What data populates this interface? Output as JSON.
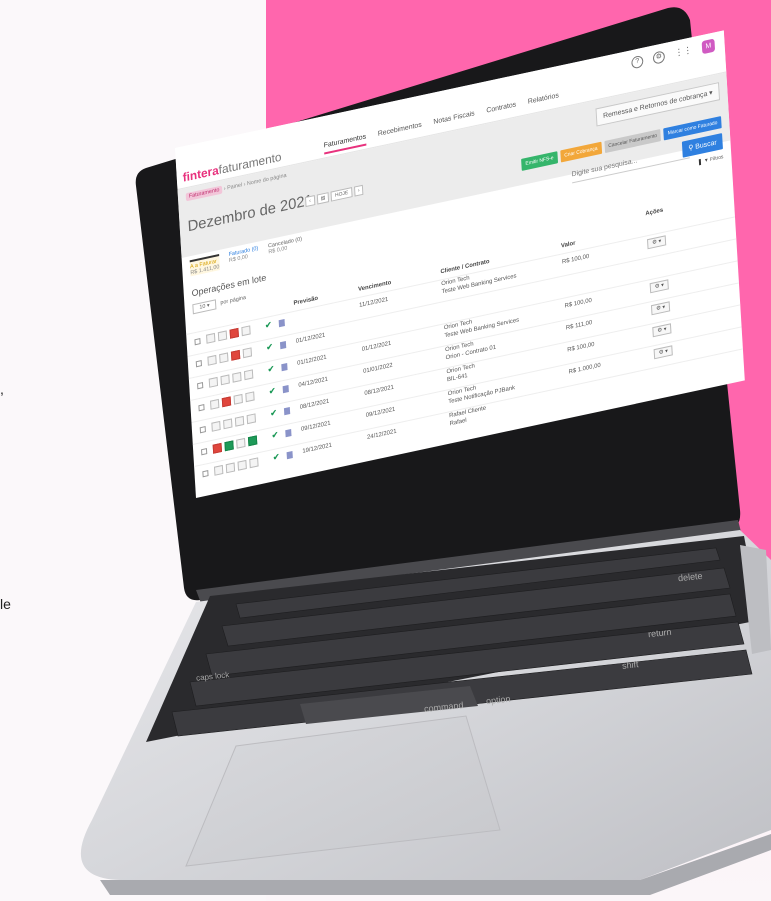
{
  "left_fragments": {
    "line1": ",",
    "line2": "le"
  },
  "colors": {
    "accent": "#e8317d",
    "pink_bg": "#ff66ad",
    "blue": "#2f80e0",
    "green": "#35b56b"
  },
  "app": {
    "logo_brand": "fintera",
    "logo_product": "faturamento",
    "nav": [
      "Faturamentos",
      "Recebimentos",
      "Notas Fiscais",
      "Contratos",
      "Relatórios"
    ],
    "avatar": "M",
    "breadcrumb": {
      "home": "Faturamento",
      "sep1": "›",
      "p1": "Painel",
      "sep2": "›",
      "p2": "Nome do página"
    },
    "remessa_label": "Remessa e Retornos de cobrança",
    "month_title": "Dezembro de 2021",
    "month_controls": [
      "‹",
      "▤",
      "HOJE",
      "›"
    ],
    "buttons": {
      "green": "Emitir NFS-e",
      "orange": "Criar Cobrança",
      "grey": "Cancelar Faturamento",
      "blue": "Marcar como Faturado"
    },
    "search_placeholder": "Digite sua pesquisa...",
    "buscar_label": "Buscar",
    "filtros_label": "Filtros",
    "status_tabs": [
      {
        "label": "A a Faturar",
        "value": "R$ 1.411,00"
      },
      {
        "label": "Faturado (0)",
        "value": "R$ 0,00"
      },
      {
        "label": "Cancelado (0)",
        "value": "R$ 0,00"
      }
    ],
    "ops_title": "Operações em lote",
    "per_page": {
      "value": "10",
      "label": "por página"
    },
    "headers": {
      "prev": "Previsão",
      "venc": "Vencimento",
      "cli": "Cliente / Contrato",
      "val": "Valor",
      "acoes": "Ações"
    },
    "rows": [
      {
        "prev": "",
        "venc": "11/12/2021",
        "cli1": "Orion Tech",
        "cli2": "Teste Web Banking Services",
        "val": "R$ 100,00",
        "act": "▾"
      },
      {
        "prev": "01/12/2021",
        "venc": "",
        "cli1": "",
        "cli2": "",
        "val": "",
        "act": ""
      },
      {
        "prev": "01/12/2021",
        "venc": "01/12/2021",
        "cli1": "Orion Tech",
        "cli2": "Teste Web Banking Services",
        "val": "R$ 100,00",
        "act": "▾"
      },
      {
        "prev": "04/12/2021",
        "venc": "01/01/2022",
        "cli1": "Orion Tech",
        "cli2": "Orion - Contrato 01",
        "val": "R$ 111,00",
        "act": "▾"
      },
      {
        "prev": "08/12/2021",
        "venc": "08/12/2021",
        "cli1": "Orion Tech",
        "cli2": "BIL-641",
        "val": "R$ 100,00",
        "act": "▾"
      },
      {
        "prev": "09/12/2021",
        "venc": "09/12/2021",
        "cli1": "Orion Tech",
        "cli2": "Teste Notificação PJBank",
        "val": "R$ 1.000,00",
        "act": "▾"
      },
      {
        "prev": "19/12/2021",
        "venc": "24/12/2021",
        "cli1": "Rafael Cliente",
        "cli2": "Rafael",
        "val": "",
        "act": ""
      }
    ]
  },
  "keyboard": {
    "delete": "delete",
    "return": "return",
    "shift": "shift",
    "command": "command",
    "option": "option",
    "caps_lock": "caps lock"
  }
}
